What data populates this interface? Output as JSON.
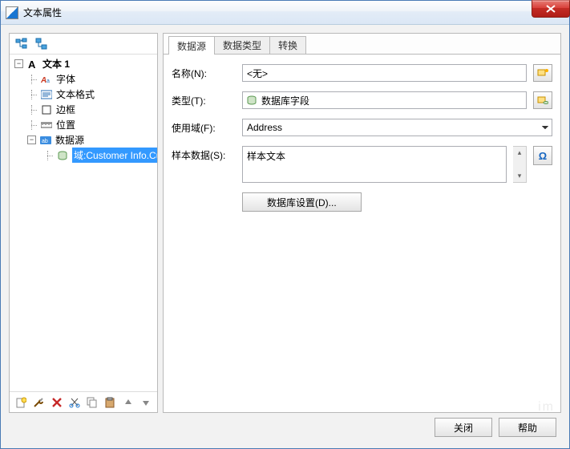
{
  "window": {
    "title": "文本属性",
    "close_tooltip": "Close"
  },
  "left": {
    "toolbar_top": [
      "expand-tree-icon",
      "add-node-icon"
    ],
    "toolbar_bottom": [
      "new-icon",
      "tools-icon",
      "delete-icon",
      "cut-icon",
      "copy-icon",
      "paste-icon",
      "move-up-icon",
      "move-down-icon"
    ],
    "root_label": "文本 1",
    "items": [
      {
        "label": "字体",
        "icon": "font-small-icon"
      },
      {
        "label": "文本格式",
        "icon": "text-format-icon"
      },
      {
        "label": "边框",
        "icon": "border-icon"
      },
      {
        "label": "位置",
        "icon": "ruler-icon"
      },
      {
        "label": "数据源",
        "icon": "datasource-icon"
      }
    ],
    "selected_child_label": "域:Customer Info.Cus"
  },
  "tabs": {
    "items": [
      "数据源",
      "数据类型",
      "转换"
    ],
    "active_index": 0
  },
  "form": {
    "name_label": "名称(N):",
    "name_value": "<无>",
    "type_label": "类型(T):",
    "type_value": "数据库字段",
    "field_label": "使用域(F):",
    "field_value": "Address",
    "sample_label": "样本数据(S):",
    "sample_value": "样本文本",
    "db_settings_label": "数据库设置(D)...",
    "omega_tooltip": "插入特殊字符"
  },
  "buttons": {
    "close": "关闭",
    "help": "帮助"
  },
  "watermark": "im"
}
